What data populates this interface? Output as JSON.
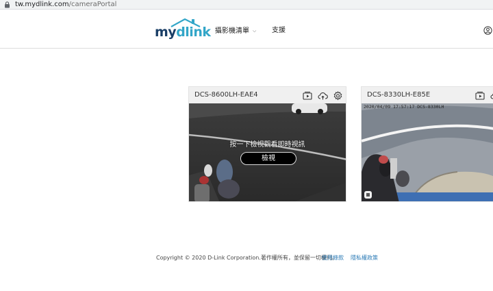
{
  "browser": {
    "url_host": "tw.mydlink.com",
    "url_path": "/cameraPortal"
  },
  "header": {
    "logo_my": "my",
    "logo_dlink": "dlink",
    "nav_cameras": "攝影機清單",
    "nav_support": "支援",
    "icons": [
      "chevron-down-icon",
      "user-icon"
    ]
  },
  "cameras": [
    {
      "name": "DCS-8600LH-EAE4",
      "prompt": "按一下檢視觀看即時視訊",
      "view_label": "檢視",
      "icons": [
        "video-playback-icon",
        "cloud-upload-icon",
        "gear-icon"
      ]
    },
    {
      "name": "DCS-8330LH-E85E",
      "timestamp": "2020/04/09  17:57:17  DCS-8330LH",
      "icons": [
        "video-playback-icon",
        "cloud-upload-icon"
      ]
    }
  ],
  "footer": {
    "copyright": "Copyright © 2020 D-Link Corporation.著作權所有，並保留一切權利。",
    "terms": "使用條款",
    "privacy": "隱私權政策"
  },
  "colors": {
    "brand_dark": "#1a3e66",
    "brand_light": "#33a6c8",
    "link": "#2c7bb6"
  }
}
